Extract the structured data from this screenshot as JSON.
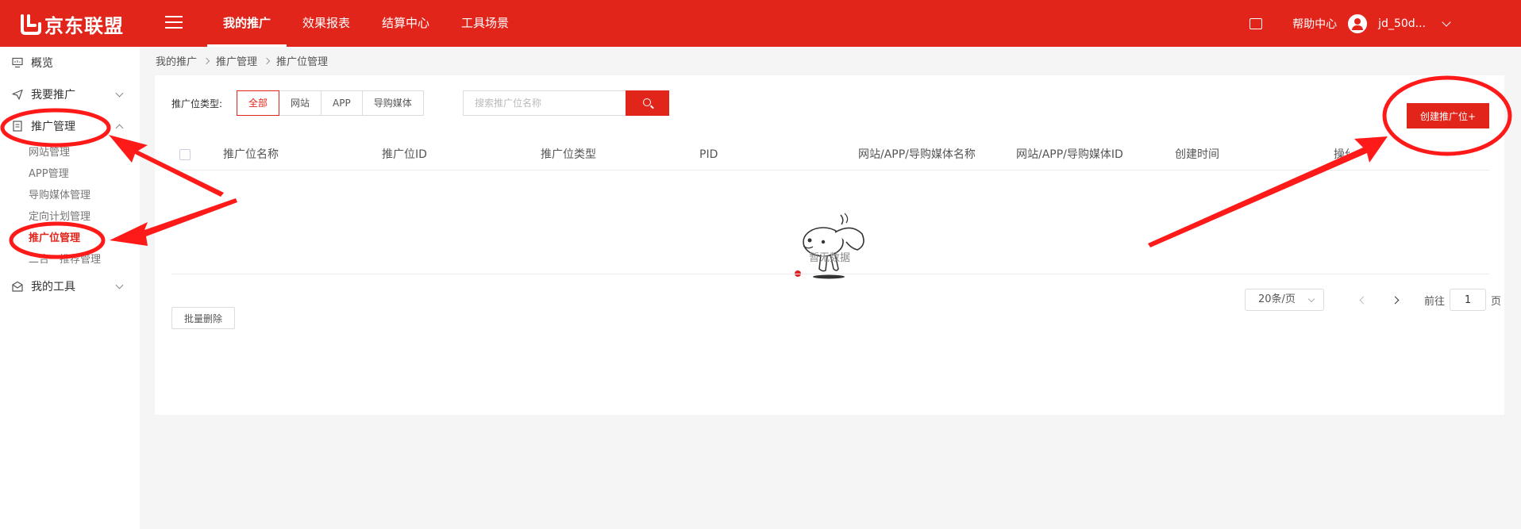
{
  "header": {
    "logo_text": "京东联盟",
    "nav": [
      {
        "label": "我的推广",
        "active": true
      },
      {
        "label": "效果报表"
      },
      {
        "label": "结算中心"
      },
      {
        "label": "工具场景"
      }
    ],
    "help": "帮助中心",
    "username": "jd_50d..."
  },
  "sidebar": {
    "overview": "概览",
    "want_promote": "我要推广",
    "promote_manage": "推广管理",
    "sub_items": [
      "网站管理",
      "APP管理",
      "导购媒体管理",
      "定向计划管理",
      "推广位管理",
      "二合一推荐管理"
    ],
    "active_sub": "推广位管理",
    "my_tools": "我的工具"
  },
  "breadcrumb": [
    "我的推广",
    "推广管理",
    "推广位管理"
  ],
  "filter": {
    "label": "推广位类型:",
    "options": [
      "全部",
      "网站",
      "APP",
      "导购媒体"
    ],
    "selected": "全部"
  },
  "search": {
    "placeholder": "搜索推广位名称",
    "value": ""
  },
  "create_button": "创建推广位+",
  "table": {
    "columns": [
      "推广位名称",
      "推广位ID",
      "推广位类型",
      "PID",
      "网站/APP/导购媒体名称",
      "网站/APP/导购媒体ID",
      "创建时间",
      "操作"
    ],
    "rows": [],
    "empty_text": "暂无数据"
  },
  "pagination": {
    "page_size": "20条/页",
    "goto_label": "前往",
    "current_page": "1",
    "suffix": "页"
  },
  "batch_delete": "批量删除",
  "colors": {
    "brand": "#e1251b",
    "annotation": "#ff1a1a"
  }
}
